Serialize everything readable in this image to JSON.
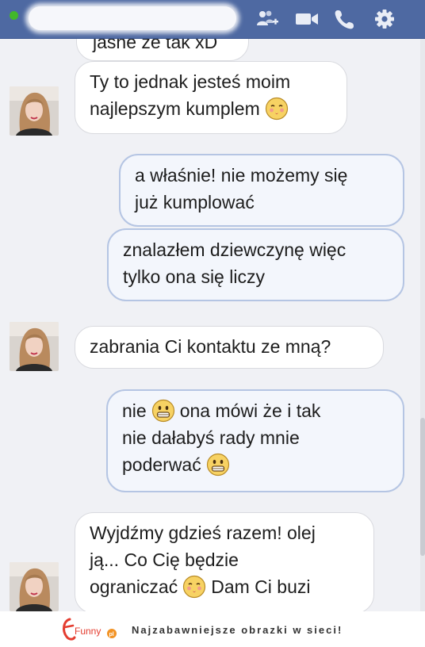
{
  "header": {
    "icons": [
      "online-status-dot",
      "add-person-icon",
      "video-call-icon",
      "phone-call-icon",
      "gear-icon"
    ],
    "status_color": "#42b72a",
    "bar_color": "#4e69a2"
  },
  "messages": [
    {
      "id": "m0",
      "side": "incoming",
      "lines": [
        "jasne że tak xD"
      ],
      "partially_visible": true
    },
    {
      "id": "m1",
      "side": "incoming",
      "lines": [
        "Ty to jednak jesteś moim",
        "najlepszym kumplem"
      ],
      "emoji": "kissing-face-icon"
    },
    {
      "id": "m2",
      "side": "outgoing",
      "lines": [
        "a właśnie! nie możemy się",
        "już kumplować"
      ]
    },
    {
      "id": "m3",
      "side": "outgoing",
      "lines": [
        "znalazłem dziewczynę więc",
        "tylko ona się liczy"
      ]
    },
    {
      "id": "m4",
      "side": "incoming",
      "lines": [
        "zabrania Ci kontaktu ze mną?"
      ]
    },
    {
      "id": "m5",
      "side": "outgoing",
      "lines": [
        "nie",
        "ona mówi że i tak",
        "nie dałabyś rady mnie",
        "poderwać"
      ],
      "emoji": "grinning-face-icon"
    },
    {
      "id": "m6",
      "side": "incoming",
      "lines": [
        "Wyjdźmy gdzieś razem! olej",
        "ją... Co Cię będzie",
        "ograniczać",
        "Dam Ci buzi"
      ],
      "emoji": "kissing-face-icon"
    }
  ],
  "footer": {
    "logo_text": "Funny",
    "logo_badge": "pl",
    "tagline": "Najzabawniejsze obrazki w sieci!"
  },
  "colors": {
    "chat_background": "#f0f1f5",
    "incoming_bubble": "#ffffff",
    "outgoing_bubble": "#f3f6fc",
    "outgoing_border": "#b5c5e3",
    "logo_red": "#e43c2f",
    "logo_orange": "#f29325"
  }
}
